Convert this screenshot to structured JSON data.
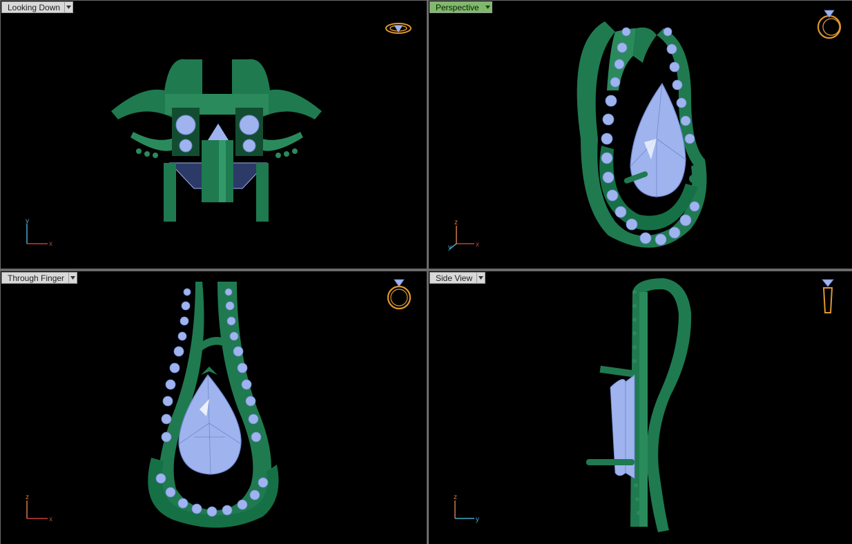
{
  "viewports": [
    {
      "title": "Looking Down",
      "active": false,
      "axes": {
        "h": "x",
        "v": "y"
      }
    },
    {
      "title": "Perspective",
      "active": true,
      "axes": {
        "h": "x",
        "v": "z",
        "d": "y"
      }
    },
    {
      "title": "Through Finger",
      "active": false,
      "axes": {
        "h": "x",
        "v": "z"
      }
    },
    {
      "title": "Side View",
      "active": false,
      "axes": {
        "h": "y",
        "v": "z"
      }
    }
  ],
  "colors": {
    "background": "#000000",
    "metal": "#1f7a4f",
    "metal_highlight": "#3fae7a",
    "gem": "#9fb4ee",
    "gem_edge": "#6f86d0",
    "active_tab": "#7fba6a",
    "tab": "#d9d9d9",
    "axis_x": "#c83c3c",
    "axis_y_top": "#4aa7c8",
    "axis_z": "#d07a4a",
    "widget": "#e0982e"
  },
  "icons": [
    "dropdown-arrow-icon",
    "ring-orientation-icon",
    "axis-triad-icon"
  ]
}
